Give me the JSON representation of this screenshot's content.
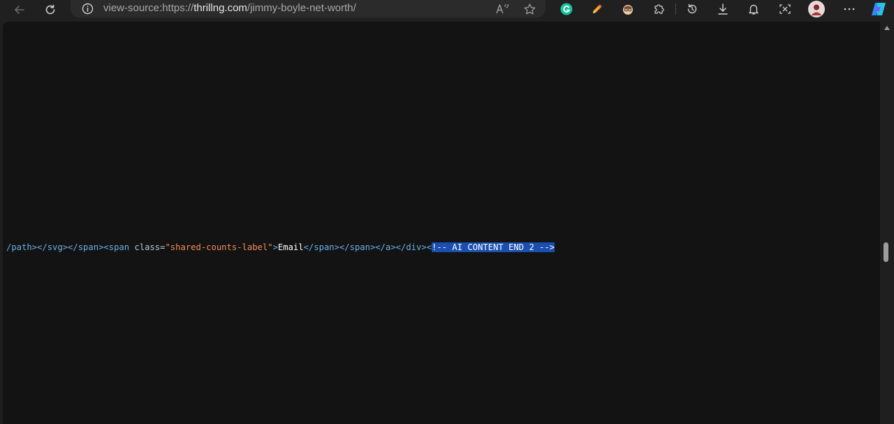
{
  "browser": {
    "address": {
      "prefix": "view-source:https://",
      "domain": "thrillng.com",
      "path": "/jimmy-boyle-net-worth/"
    }
  },
  "source": {
    "segments": [
      {
        "kind": "tag",
        "text": "/path></svg></span><span "
      },
      {
        "kind": "attr",
        "text": "class="
      },
      {
        "kind": "val",
        "text": "\"shared-counts-label\""
      },
      {
        "kind": "tag",
        "text": ">"
      },
      {
        "kind": "txt",
        "text": "Email"
      },
      {
        "kind": "tag",
        "text": "</span></span></a></div><"
      },
      {
        "kind": "sel",
        "text": "!-- AI CONTENT END 2 -->"
      }
    ]
  },
  "colors": {
    "toolbar": "#202020",
    "viewport": "#131313",
    "selection": "#1a4fb0",
    "tag": "#6ab0e8",
    "attr_value": "#f48d5b"
  }
}
